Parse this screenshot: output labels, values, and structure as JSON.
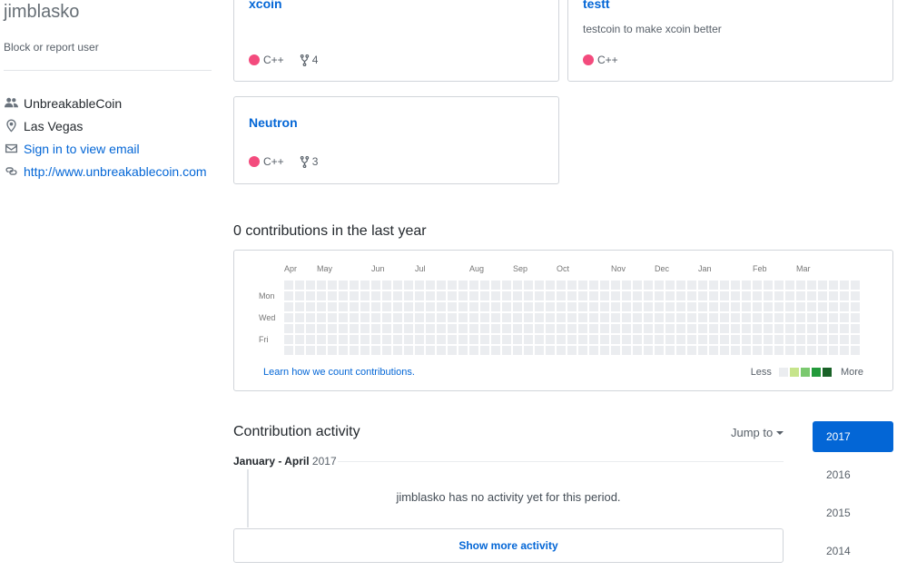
{
  "profile": {
    "username": "jimblasko",
    "block_label": "Block or report user",
    "organization": "UnbreakableCoin",
    "location": "Las Vegas",
    "email_link": "Sign in to view email",
    "website": "http://www.unbreakablecoin.com"
  },
  "repos": [
    {
      "name": "xcoin",
      "description": "",
      "language": "C++",
      "language_color": "#f34b7d",
      "forks": "4"
    },
    {
      "name": "testt",
      "description": "testcoin to make xcoin better",
      "language": "C++",
      "language_color": "#f34b7d",
      "forks": ""
    },
    {
      "name": "Neutron",
      "description": "",
      "language": "C++",
      "language_color": "#f34b7d",
      "forks": "3"
    }
  ],
  "contributions": {
    "title": "0 contributions in the last year",
    "months": [
      "Apr",
      "May",
      "Jun",
      "Jul",
      "Aug",
      "Sep",
      "Oct",
      "Nov",
      "Dec",
      "Jan",
      "Feb",
      "Mar"
    ],
    "days": [
      "Mon",
      "Wed",
      "Fri"
    ],
    "learn_link": "Learn how we count contributions.",
    "legend_less": "Less",
    "legend_more": "More",
    "legend_colors": [
      "#ebedf0",
      "#c6e48b",
      "#7bc96f",
      "#239a3b",
      "#196127"
    ],
    "empty_color": "#ebedf0",
    "weeks": 53,
    "total": 0
  },
  "activity": {
    "title": "Contribution activity",
    "jump_to": "Jump to",
    "period": "January - April",
    "period_year": "2017",
    "no_activity": "jimblasko has no activity yet for this period.",
    "show_more": "Show more activity",
    "years": [
      "2017",
      "2016",
      "2015",
      "2014"
    ],
    "selected_year": "2017"
  },
  "colors": {
    "link": "#0366d6",
    "accent": "#0366d6"
  }
}
